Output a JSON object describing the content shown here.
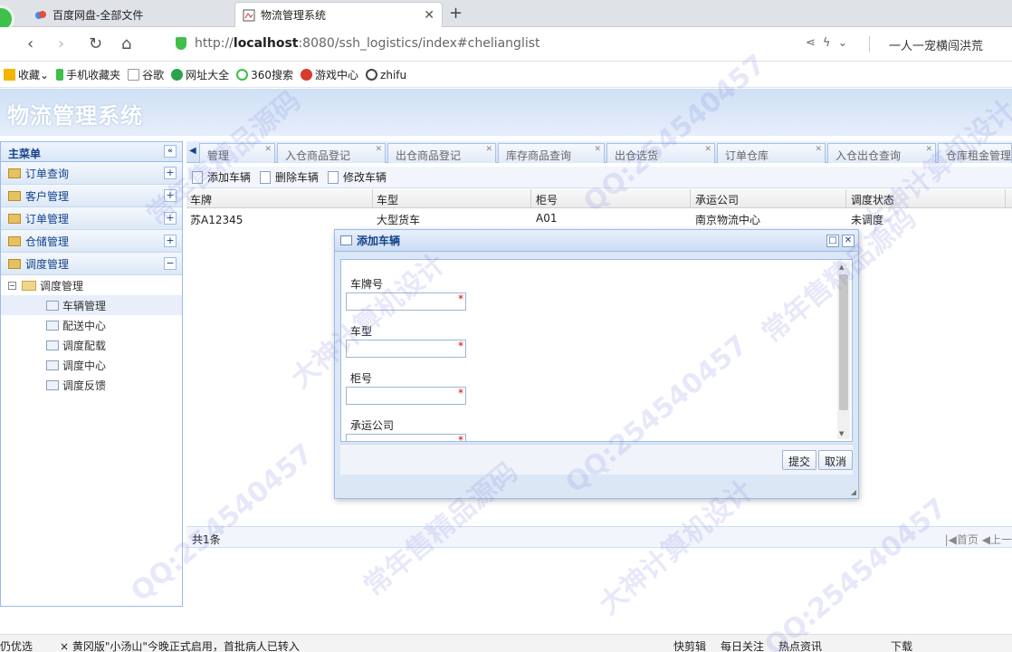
{
  "browser": {
    "tabs": [
      {
        "label": "百度网盘-全部文件"
      },
      {
        "label": "物流管理系统"
      }
    ],
    "url_prefix": "http://",
    "url_host": "localhost",
    "url_rest": ":8080/ssh_logistics/index#chelianglist",
    "user_label": "一人一宠横闯洪荒",
    "bookmarks": [
      "收藏",
      "手机收藏夹",
      "谷歌",
      "网址大全",
      "360搜索",
      "游戏中心",
      "zhifu"
    ]
  },
  "app": {
    "title": "物流管理系统",
    "sidebar": {
      "title": "主菜单",
      "sections": [
        "订单查询",
        "客户管理",
        "订单管理",
        "仓储管理",
        "调度管理"
      ],
      "tree_root": "调度管理",
      "tree_items": [
        "车辆管理",
        "配送中心",
        "调度配载",
        "调度中心",
        "调度反馈"
      ]
    },
    "tabs": [
      "管理",
      "入仓商品登记",
      "出仓商品登记",
      "库存商品查询",
      "出仓选货",
      "订单仓库",
      "入仓出仓查询",
      "仓库租金管理"
    ],
    "toolbar": {
      "add": "添加车辆",
      "delete": "删除车辆",
      "edit": "修改车辆"
    },
    "grid": {
      "columns": [
        "车牌",
        "车型",
        "柜号",
        "承运公司",
        "调度状态"
      ],
      "rows": [
        [
          "苏A12345",
          "大型货车",
          "A01",
          "南京物流中心",
          "未调度"
        ]
      ]
    },
    "pager": {
      "total": "共1条",
      "first": "首页",
      "prev": "上一"
    }
  },
  "dialog": {
    "title": "添加车辆",
    "fields": [
      "车牌号",
      "车型",
      "柜号",
      "承运公司"
    ],
    "required_mark": "*",
    "submit": "提交",
    "cancel": "取消"
  },
  "statusbar": {
    "left": "仍优选",
    "news": "× 黄冈版\"小汤山\"今晚正式启用，首批病人已转入",
    "right": [
      "快剪辑",
      "每日关注",
      "热点资讯",
      "下载"
    ]
  },
  "watermarks": [
    "QQ:254540457",
    "常年售精品源码",
    "大神计算机设计"
  ]
}
